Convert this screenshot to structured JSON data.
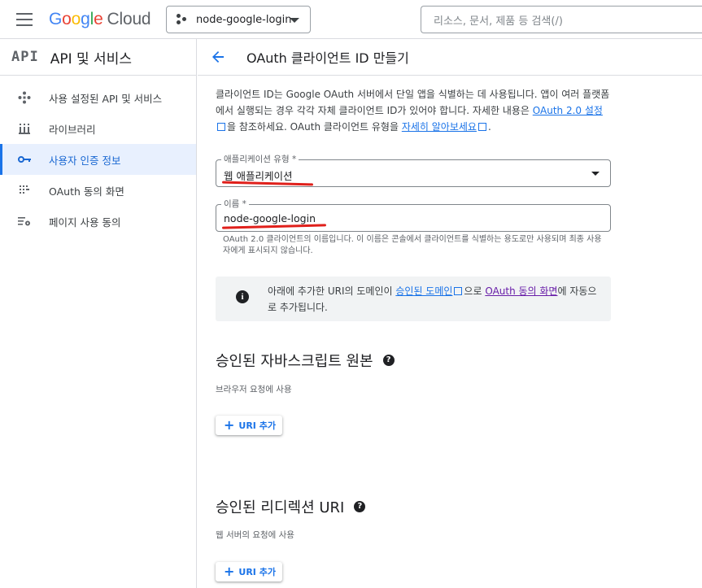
{
  "header": {
    "logo_google": [
      "G",
      "o",
      "o",
      "g",
      "l",
      "e"
    ],
    "logo_cloud": "Cloud",
    "project_name": "node-google-login",
    "search_placeholder": "리소스, 문서, 제품 등 검색(/)"
  },
  "sidebar": {
    "logo": "API",
    "title": "API 및 서비스",
    "items": [
      {
        "label": "사용 설정된 API 및 서비스",
        "icon": "api-diamond-icon",
        "active": false
      },
      {
        "label": "라이브러리",
        "icon": "library-icon",
        "active": false
      },
      {
        "label": "사용자 인증 정보",
        "icon": "key-icon",
        "active": true
      },
      {
        "label": "OAuth 동의 화면",
        "icon": "oauth-consent-icon",
        "active": false
      },
      {
        "label": "페이지 사용 동의",
        "icon": "page-settings-icon",
        "active": false
      }
    ]
  },
  "main": {
    "title": "OAuth 클라이언트 ID 만들기",
    "intro": {
      "part1": "클라이언트 ID는 Google OAuth 서버에서 단일 앱을 식별하는 데 사용됩니다. 앱이 여러 플랫폼에서 실행되는 경우 각각 자체 클라이언트 ID가 있어야 합니다. 자세한 내용은 ",
      "link1": "OAuth 2.0 설정",
      "part2": "을 참조하세요. OAuth 클라이언트 유형을 ",
      "link2": "자세히 알아보세요",
      "part3": "."
    },
    "app_type": {
      "label": "애플리케이션 유형 *",
      "value": "웹 애플리케이션"
    },
    "name_field": {
      "label": "이름 *",
      "value": "node-google-login",
      "helper": "OAuth 2.0 클라이언트의 이름입니다. 이 이름은 콘솔에서 클라이언트를 식별하는 용도로만 사용되며 최종 사용자에게 표시되지 않습니다."
    },
    "info": {
      "part1": "아래에 추가한 URI의 도메인이 ",
      "link1": "승인된 도메인",
      "part2": "으로 ",
      "link2": "OAuth 동의 화면",
      "part3": "에 자동으로 추가됩니다."
    },
    "js_origins": {
      "title": "승인된 자바스크립트 원본",
      "subtitle": "브라우저 요청에 사용",
      "button": "URI 추가"
    },
    "redirect_uris": {
      "title": "승인된 리디렉션 URI",
      "subtitle": "웹 서버의 요청에 사용",
      "button": "URI 추가"
    }
  },
  "colors": {
    "accent": "#1a73e8",
    "annotation_red": "#e0201b",
    "active_bg": "#e8f0fe"
  }
}
